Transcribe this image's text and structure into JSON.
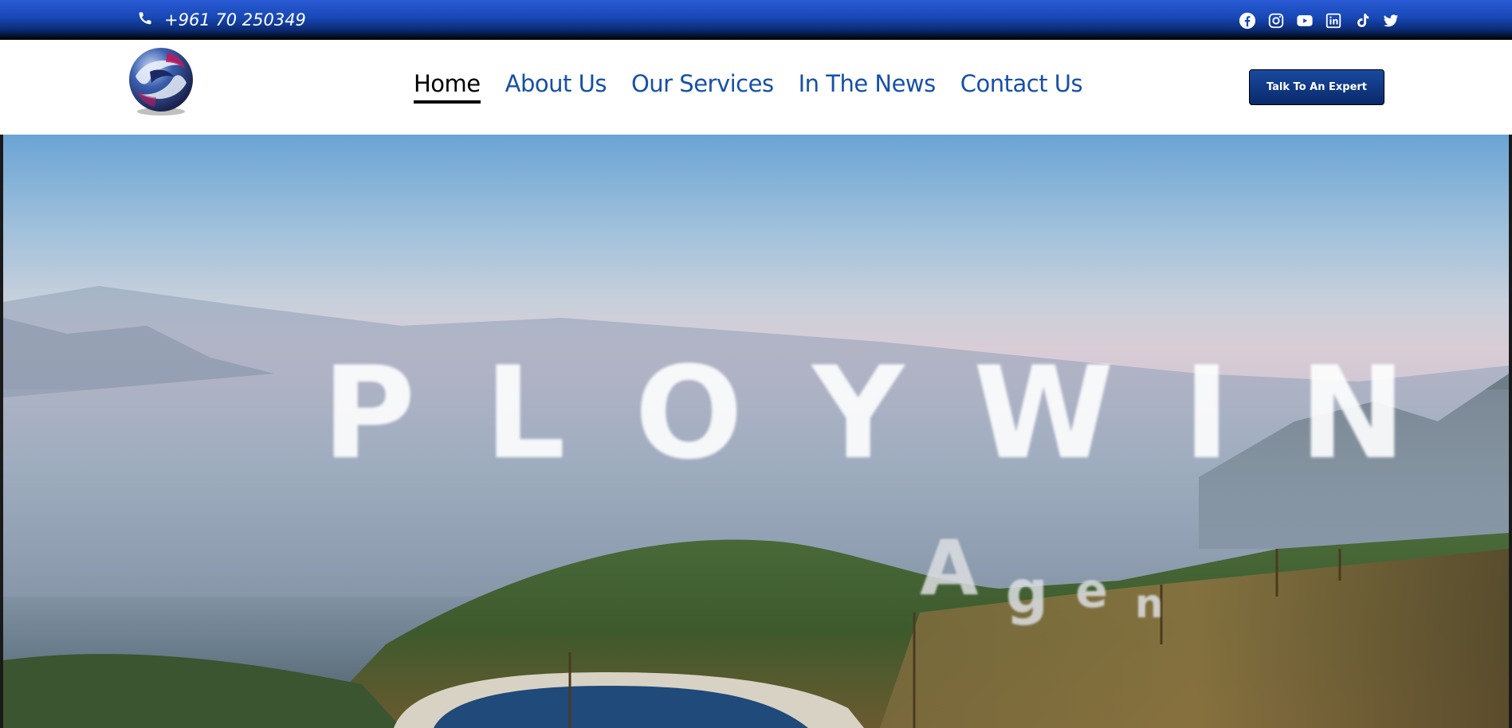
{
  "topbar": {
    "phone": "+961 70 250349",
    "phone_icon": "phone-icon",
    "social_icons": [
      "facebook-icon",
      "instagram-icon",
      "youtube-icon",
      "linkedin-icon",
      "tiktok-icon",
      "twitter-icon"
    ]
  },
  "nav": {
    "items": [
      {
        "label": "Home",
        "active": true
      },
      {
        "label": "About Us",
        "active": false
      },
      {
        "label": "Our Services",
        "active": false
      },
      {
        "label": "In The News",
        "active": false
      },
      {
        "label": "Contact Us",
        "active": false
      }
    ],
    "cta_label": "Talk To An Expert"
  },
  "hero": {
    "title_letters": [
      "P",
      "L",
      "O",
      "Y",
      "W",
      "I",
      "N"
    ],
    "subtitle_letters": [
      "A",
      "g",
      "e",
      "n"
    ]
  },
  "colors": {
    "accent": "#1650a8",
    "topbar": "#1747b4",
    "cta": "#08296a"
  }
}
